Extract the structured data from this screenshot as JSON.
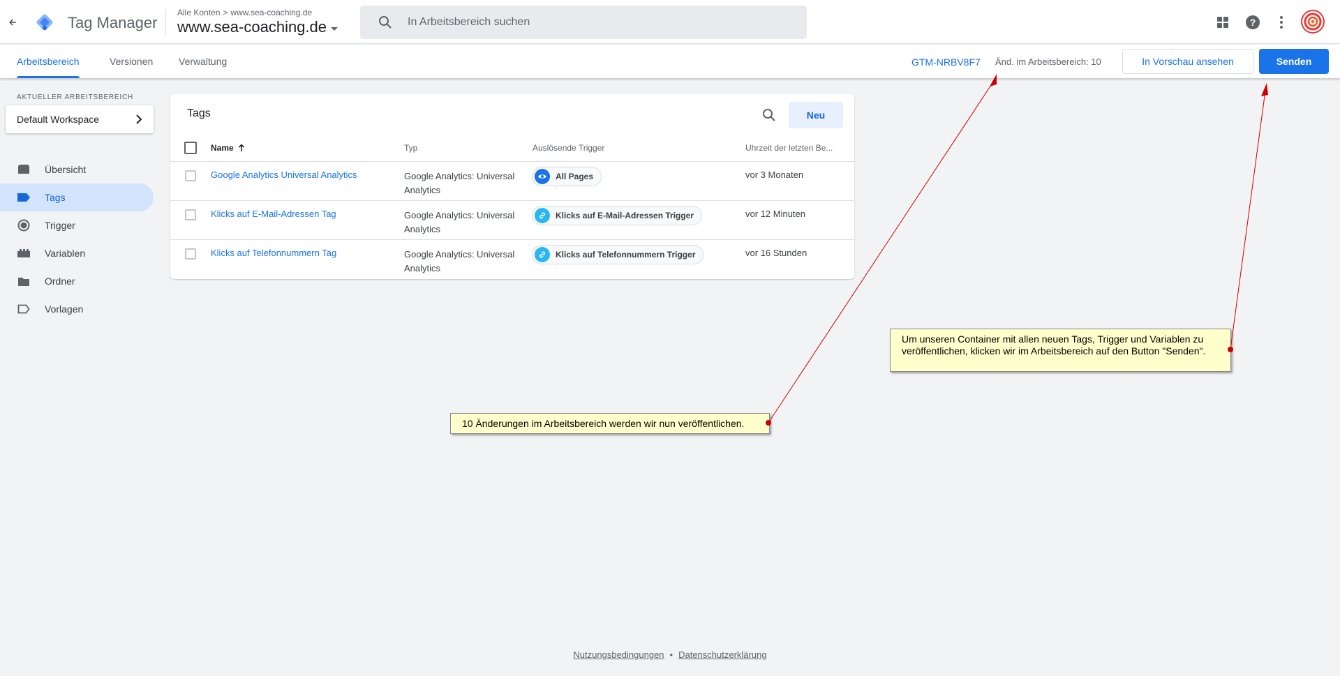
{
  "header": {
    "app_title": "Tag Manager",
    "breadcrumb": {
      "account": "Alle Konten",
      "container": "www.sea-coaching.de"
    },
    "container_name": "www.sea-coaching.de",
    "search_placeholder": "In Arbeitsbereich suchen"
  },
  "subnav": {
    "tabs": [
      {
        "label": "Arbeitsbereich",
        "active": true
      },
      {
        "label": "Versionen",
        "active": false
      },
      {
        "label": "Verwaltung",
        "active": false
      }
    ],
    "container_id": "GTM-NRBV8F7",
    "changes_label": "Änd. im Arbeitsbereich: 10",
    "preview_button": "In Vorschau ansehen",
    "send_button": "Senden"
  },
  "sidebar": {
    "workspace_label": "AKTUELLER ARBEITSBEREICH",
    "workspace_name": "Default Workspace",
    "items": [
      {
        "label": "Übersicht",
        "icon": "overview-icon"
      },
      {
        "label": "Tags",
        "icon": "tag-icon",
        "active": true
      },
      {
        "label": "Trigger",
        "icon": "trigger-icon"
      },
      {
        "label": "Variablen",
        "icon": "variables-icon"
      },
      {
        "label": "Ordner",
        "icon": "folder-icon"
      },
      {
        "label": "Vorlagen",
        "icon": "template-icon"
      }
    ]
  },
  "tags_table": {
    "title": "Tags",
    "new_button": "Neu",
    "columns": [
      "Name",
      "Typ",
      "Auslösende Trigger",
      "Uhrzeit der letzten Be..."
    ],
    "rows": [
      {
        "name": "Google Analytics Universal Analytics",
        "type": "Google Analytics: Universal Analytics",
        "trigger": "All Pages",
        "trigger_icon": "eye-icon",
        "time": "vor 3 Monaten"
      },
      {
        "name": "Klicks auf E-Mail-Adressen Tag",
        "type": "Google Analytics: Universal Analytics",
        "trigger": "Klicks auf E-Mail-Adressen Trigger",
        "trigger_icon": "link-icon",
        "time": "vor 12 Minuten"
      },
      {
        "name": "Klicks auf Telefonnummern Tag",
        "type": "Google Analytics: Universal Analytics",
        "trigger": "Klicks auf Telefonnummern Trigger",
        "trigger_icon": "link-icon",
        "time": "vor 16 Stunden"
      }
    ]
  },
  "annotations": {
    "note_changes": "10 Änderungen im Arbeitsbereich werden wir nun veröffentlichen.",
    "note_send": "Um unseren Container mit allen neuen Tags, Trigger und Variablen zu veröffentlichen, klicken wir im Arbeitsbereich auf den Button \"Senden\"."
  },
  "footer": {
    "terms": "Nutzungsbedingungen",
    "separator": "•",
    "privacy": "Datenschutzerklärung"
  },
  "colors": {
    "accent": "#1a73e8",
    "nav_active_bg": "#d2e3fc",
    "annotation_bg": "#ffffcc",
    "annotation_arrow": "#cc0000"
  }
}
